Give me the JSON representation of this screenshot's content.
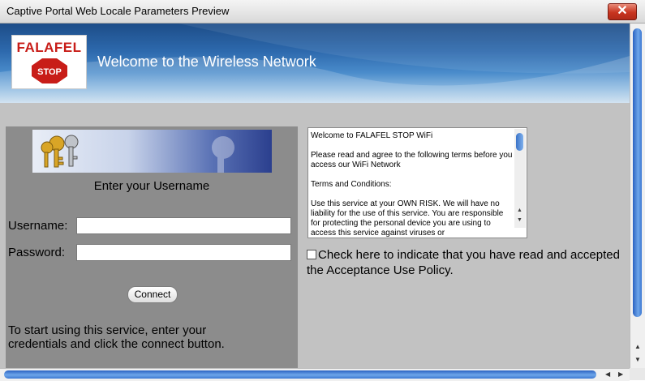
{
  "window": {
    "title": "Captive Portal Web Locale Parameters Preview",
    "close_glyph": "✕"
  },
  "banner": {
    "logo_text": "FALAFEL",
    "logo_sign_text": "STOP",
    "heading": "Welcome to the Wireless Network"
  },
  "login": {
    "prompt": "Enter your Username",
    "username_label": "Username:",
    "username_value": "",
    "password_label": "Password:",
    "password_value": "",
    "connect_label": "Connect",
    "instructions": "To start using this service, enter your credentials and click the connect button."
  },
  "terms": {
    "paragraphs": [
      "Welcome to FALAFEL STOP WiFi",
      "Please read and agree to the following terms before you access our WiFi Network",
      "Terms and Conditions:",
      "Use this service at your OWN RISK. We will have no liability for the use of this service. You are responsible for protecting the personal device you are using to access this service against viruses or"
    ]
  },
  "acceptance": {
    "text": "Check here to indicate that you have read and accepted the Acceptance Use Policy.",
    "checked": false
  },
  "colors": {
    "brand_red": "#c81d18",
    "banner_blue": "#2d69ad",
    "scroll_blue": "#3c78d2"
  },
  "icons": [
    "close-icon",
    "keys-icon",
    "stop-sign-icon",
    "scroll-up-icon",
    "scroll-down-icon",
    "scroll-left-icon",
    "scroll-right-icon"
  ]
}
